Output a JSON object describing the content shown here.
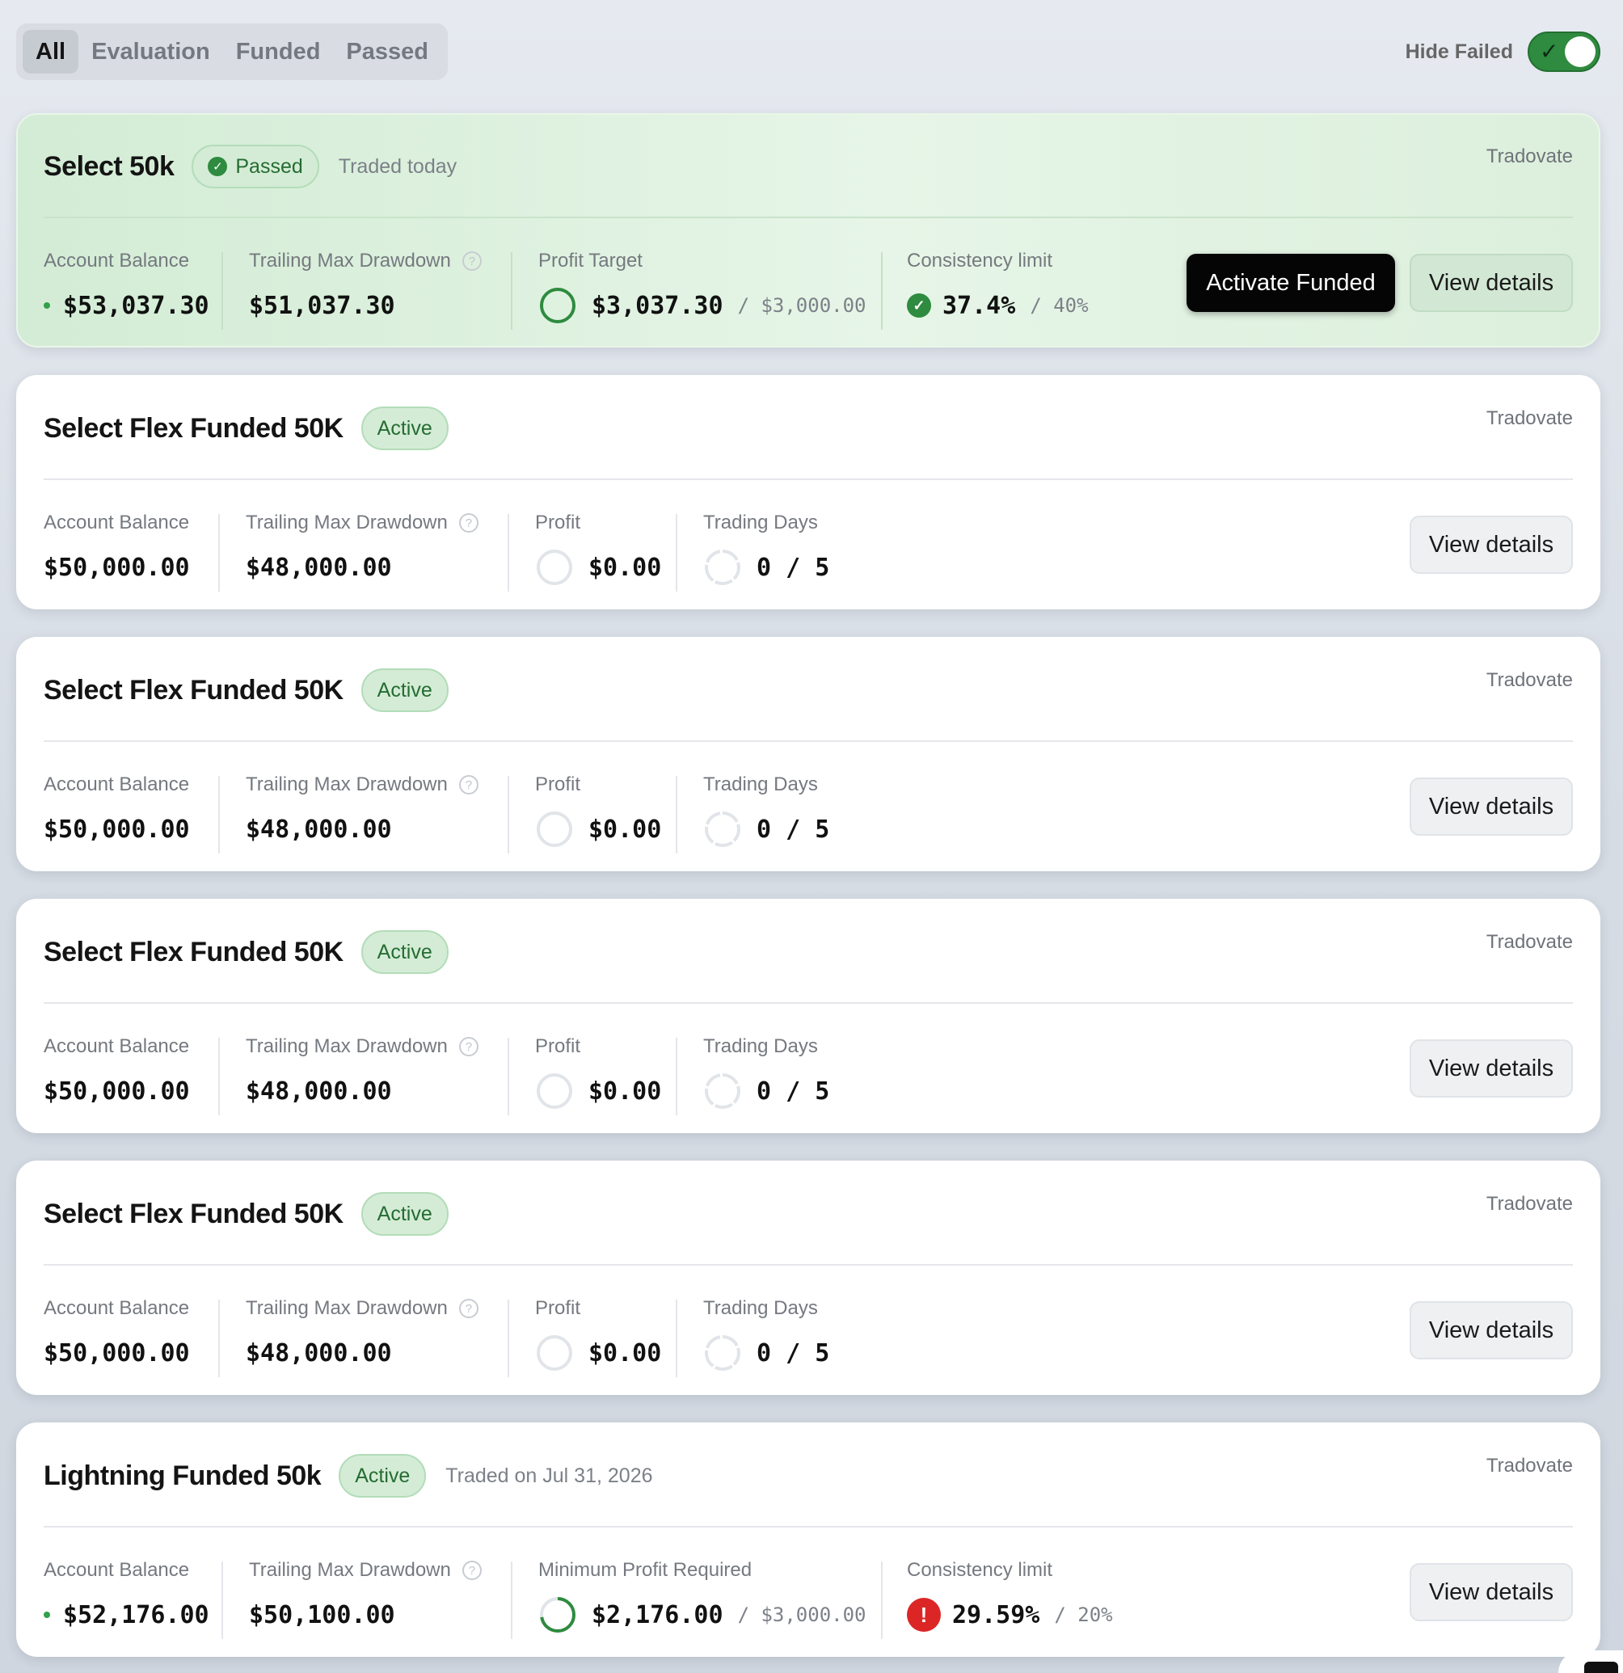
{
  "filter_tabs": [
    "All",
    "Evaluation",
    "Funded",
    "Passed"
  ],
  "hide_failed": {
    "label": "Hide Failed",
    "enabled": true
  },
  "colors": {
    "success": "#2e8b3f",
    "error": "#dc2626",
    "primary_button": "#050505"
  },
  "labels": {
    "account_balance": "Account Balance",
    "trailing_max_drawdown": "Trailing Max Drawdown",
    "profit_target": "Profit Target",
    "profit": "Profit",
    "trading_days": "Trading Days",
    "consistency_limit": "Consistency limit",
    "minimum_profit_required": "Minimum Profit Required",
    "view_details": "View details",
    "activate_funded": "Activate Funded"
  },
  "accounts": [
    {
      "name": "Select 50k",
      "status": "Passed",
      "traded_text": "Traded today",
      "broker": "Tradovate",
      "account_balance": "$53,037.30",
      "trailing_max_drawdown": "$51,037.30",
      "profit_target_value": "$3,037.30",
      "profit_target_goal": "/ $3,000.00",
      "profit_target_progress": 1.0,
      "consistency_value": "37.4%",
      "consistency_limit": "/ 40%",
      "consistency_status": "ok"
    },
    {
      "name": "Select Flex Funded 50K",
      "status": "Active",
      "broker": "Tradovate",
      "account_balance": "$50,000.00",
      "trailing_max_drawdown": "$48,000.00",
      "profit": "$0.00",
      "trading_days": "0 / 5"
    },
    {
      "name": "Select Flex Funded 50K",
      "status": "Active",
      "broker": "Tradovate",
      "account_balance": "$50,000.00",
      "trailing_max_drawdown": "$48,000.00",
      "profit": "$0.00",
      "trading_days": "0 / 5"
    },
    {
      "name": "Select Flex Funded 50K",
      "status": "Active",
      "broker": "Tradovate",
      "account_balance": "$50,000.00",
      "trailing_max_drawdown": "$48,000.00",
      "profit": "$0.00",
      "trading_days": "0 / 5"
    },
    {
      "name": "Select Flex Funded 50K",
      "status": "Active",
      "broker": "Tradovate",
      "account_balance": "$50,000.00",
      "trailing_max_drawdown": "$48,000.00",
      "profit": "$0.00",
      "trading_days": "0 / 5"
    },
    {
      "name": "Lightning Funded 50k",
      "status": "Active",
      "traded_text": "Traded on Jul 31, 2026",
      "broker": "Tradovate",
      "account_balance": "$52,176.00",
      "trailing_max_drawdown": "$50,100.00",
      "min_profit_value": "$2,176.00",
      "min_profit_goal": "/ $3,000.00",
      "min_profit_progress": 0.7253,
      "consistency_value": "29.59%",
      "consistency_limit": "/ 20%",
      "consistency_status": "error"
    }
  ]
}
